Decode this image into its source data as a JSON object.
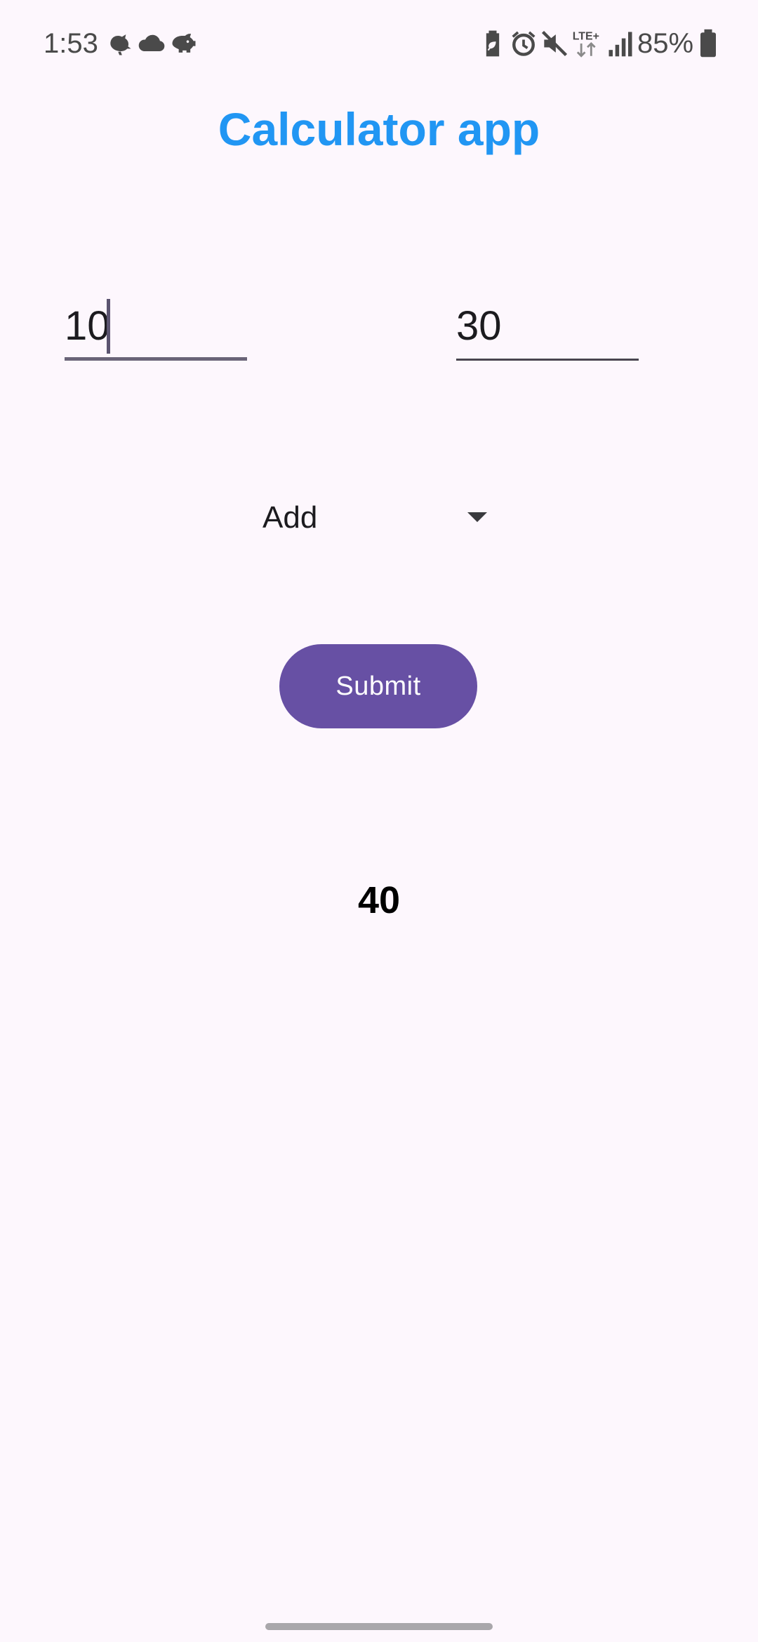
{
  "status_bar": {
    "time": "1:53",
    "battery_percent": "85%",
    "notification_icons": [
      "bird-icon",
      "cloud-icon",
      "piggy-bank-icon"
    ],
    "system_icons": [
      "battery-saver-icon",
      "alarm-icon",
      "mute-icon",
      "lte-plus-icon",
      "signal-icon",
      "battery-icon"
    ],
    "network_label": "LTE+"
  },
  "app": {
    "title": "Calculator app",
    "title_color": "#2196f3"
  },
  "inputs": {
    "first_value": "10",
    "second_value": "30"
  },
  "operation": {
    "selected": "Add"
  },
  "actions": {
    "submit_label": "Submit",
    "submit_color": "#6750a4"
  },
  "result": {
    "value": "40"
  }
}
